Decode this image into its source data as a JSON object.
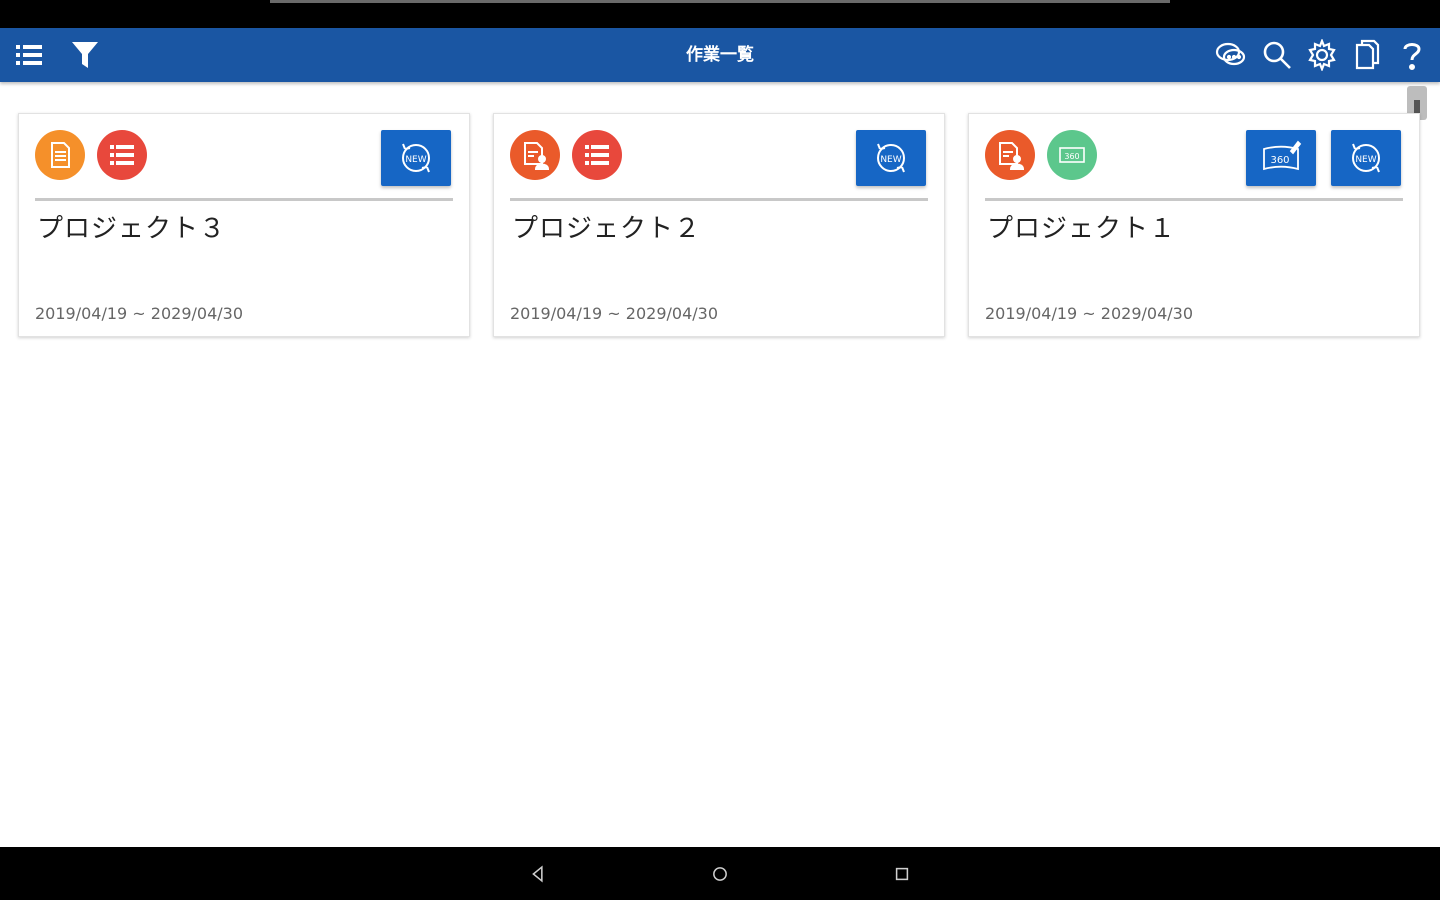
{
  "app_bar": {
    "title": "作業一覧",
    "left_icons": [
      "menu-icon",
      "filter-icon"
    ],
    "right_icons": [
      "chat-icon",
      "search-icon",
      "gear-icon",
      "pages-icon",
      "help-icon"
    ],
    "background": "#1a56a3"
  },
  "projects": [
    {
      "name": "プロジェクト３",
      "dates": "2019/04/19 ~ 2029/04/30",
      "status_icons": [
        {
          "icon": "document-icon",
          "color": "#f5902a"
        },
        {
          "icon": "list-icon",
          "color": "#e8483c"
        }
      ],
      "actions": [
        "new-sync-icon"
      ]
    },
    {
      "name": "プロジェクト２",
      "dates": "2019/04/19 ~ 2029/04/30",
      "status_icons": [
        {
          "icon": "document-user-icon",
          "color": "#ea5a2a"
        },
        {
          "icon": "list-icon",
          "color": "#e8483c"
        }
      ],
      "actions": [
        "new-sync-icon"
      ]
    },
    {
      "name": "プロジェクト１",
      "dates": "2019/04/19 ~ 2029/04/30",
      "status_icons": [
        {
          "icon": "document-user-icon",
          "color": "#ea5a2a"
        },
        {
          "icon": "panorama-360-icon",
          "color": "#5cc78c"
        }
      ],
      "actions": [
        "panorama-360-edit-icon",
        "new-sync-icon"
      ]
    }
  ],
  "nav_bar": {
    "buttons": [
      "back-icon",
      "home-icon",
      "recents-icon"
    ]
  }
}
